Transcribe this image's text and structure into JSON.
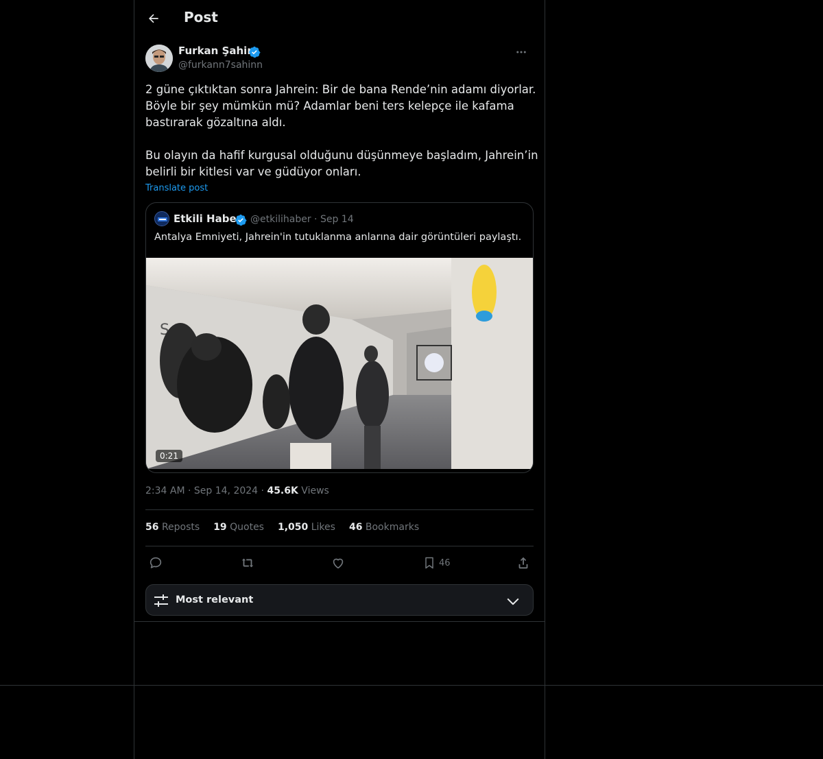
{
  "header": {
    "title": "Post"
  },
  "post": {
    "author": {
      "name": "Furkan Şahin",
      "handle": "@furkann7sahinn"
    },
    "text_lines": [
      "2 güne çıktıktan sonra Jahrein: Bir de bana Rende’nin adamı diyorlar.",
      "Böyle bir şey mümkün mü? Adamlar beni ters kelepçe ile kafama",
      "bastırarak gözaltına aldı.",
      "",
      "Bu olayın da hafif kurgusal olduğunu düşünmeye başladım, Jahrein’in",
      "belirli bir kitlesi var ve güdüyor onları."
    ],
    "translate_label": "Translate post",
    "quote": {
      "name": "Etkili Haber",
      "handle": "@etkilihaber",
      "date": "Sep 14",
      "text": "Antalya Emniyeti, Jahrein'in tutuklanma anlarına dair görüntüleri paylaştı.",
      "video_duration": "0:21"
    },
    "meta": {
      "time": "2:34 AM",
      "date": "Sep 14, 2024",
      "views_count": "45.6K",
      "views_label": "Views"
    },
    "stats": [
      {
        "count": "56",
        "label": "Reposts"
      },
      {
        "count": "19",
        "label": "Quotes"
      },
      {
        "count": "1,050",
        "label": "Likes"
      },
      {
        "count": "46",
        "label": "Bookmarks"
      }
    ],
    "actions": {
      "bookmark_count": "46"
    }
  },
  "replies_sort": {
    "label": "Most relevant"
  },
  "colors": {
    "background": "#000000",
    "text": "#e7e9ea",
    "muted": "#71767b",
    "accent": "#1d9bf0",
    "border": "#2f3336"
  }
}
